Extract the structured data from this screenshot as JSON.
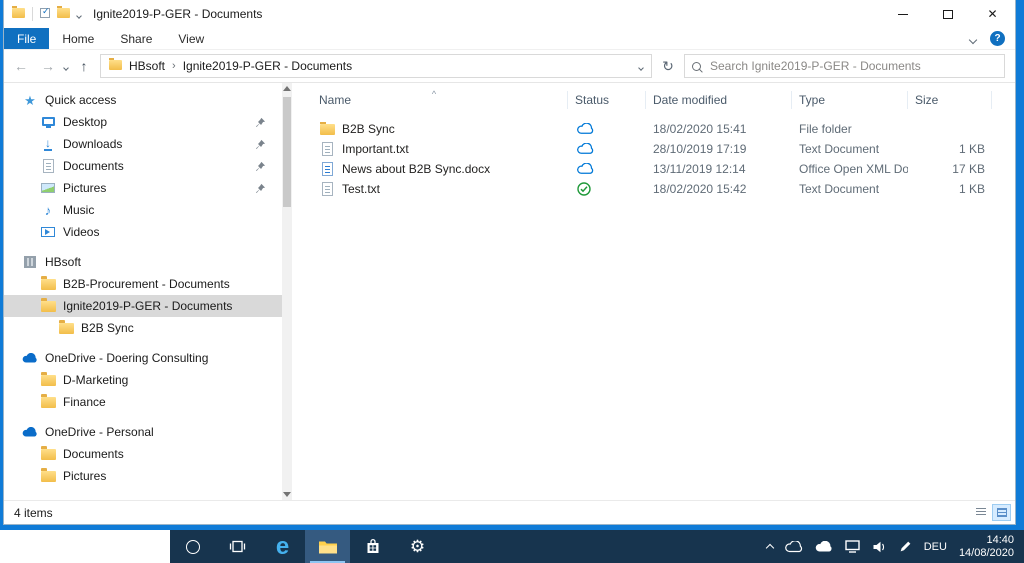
{
  "window": {
    "title": "Ignite2019-P-GER - Documents"
  },
  "ribbon": {
    "tabs": [
      {
        "label": "File",
        "active": true
      },
      {
        "label": "Home",
        "active": false
      },
      {
        "label": "Share",
        "active": false
      },
      {
        "label": "View",
        "active": false
      }
    ]
  },
  "addressbar": {
    "crumbs": [
      "HBsoft",
      "Ignite2019-P-GER - Documents"
    ],
    "search_placeholder": "Search Ignite2019-P-GER - Documents"
  },
  "sidebar": {
    "items": [
      {
        "label": "Quick access",
        "icon": "star",
        "level": 0,
        "pinned": false,
        "selected": false,
        "gap": false
      },
      {
        "label": "Desktop",
        "icon": "desktop",
        "level": 1,
        "pinned": true,
        "selected": false,
        "gap": false
      },
      {
        "label": "Downloads",
        "icon": "download",
        "level": 1,
        "pinned": true,
        "selected": false,
        "gap": false
      },
      {
        "label": "Documents",
        "icon": "document",
        "level": 1,
        "pinned": true,
        "selected": false,
        "gap": false
      },
      {
        "label": "Pictures",
        "icon": "pictures",
        "level": 1,
        "pinned": true,
        "selected": false,
        "gap": false
      },
      {
        "label": "Music",
        "icon": "music",
        "level": 1,
        "pinned": false,
        "selected": false,
        "gap": false
      },
      {
        "label": "Videos",
        "icon": "videos",
        "level": 1,
        "pinned": false,
        "selected": false,
        "gap": false
      },
      {
        "label": "HBsoft",
        "icon": "building",
        "level": 0,
        "pinned": false,
        "selected": false,
        "gap": true
      },
      {
        "label": "B2B-Procurement - Documents",
        "icon": "folder",
        "level": 1,
        "pinned": false,
        "selected": false,
        "gap": false
      },
      {
        "label": "Ignite2019-P-GER - Documents",
        "icon": "folder",
        "level": 1,
        "pinned": false,
        "selected": true,
        "gap": false
      },
      {
        "label": "B2B Sync",
        "icon": "folder",
        "level": 2,
        "pinned": false,
        "selected": false,
        "gap": false
      },
      {
        "label": "OneDrive - Doering Consulting",
        "icon": "cloud",
        "level": 0,
        "pinned": false,
        "selected": false,
        "gap": true
      },
      {
        "label": "D-Marketing",
        "icon": "folder",
        "level": 1,
        "pinned": false,
        "selected": false,
        "gap": false
      },
      {
        "label": "Finance",
        "icon": "folder",
        "level": 1,
        "pinned": false,
        "selected": false,
        "gap": false
      },
      {
        "label": "OneDrive - Personal",
        "icon": "cloud",
        "level": 0,
        "pinned": false,
        "selected": false,
        "gap": true
      },
      {
        "label": "Documents",
        "icon": "folder",
        "level": 1,
        "pinned": false,
        "selected": false,
        "gap": false
      },
      {
        "label": "Pictures",
        "icon": "folder",
        "level": 1,
        "pinned": false,
        "selected": false,
        "gap": false
      }
    ]
  },
  "file_list": {
    "columns": [
      "Name",
      "Status",
      "Date modified",
      "Type",
      "Size"
    ],
    "rows": [
      {
        "name": "B2B Sync",
        "icon": "folder",
        "status": "cloud",
        "modified": "18/02/2020 15:41",
        "type": "File folder",
        "size": ""
      },
      {
        "name": "Important.txt",
        "icon": "txt",
        "status": "cloud",
        "modified": "28/10/2019 17:19",
        "type": "Text Document",
        "size": "1 KB"
      },
      {
        "name": "News about B2B Sync.docx",
        "icon": "docx",
        "status": "cloud",
        "modified": "13/11/2019 12:14",
        "type": "Office Open XML Do...",
        "size": "17 KB"
      },
      {
        "name": "Test.txt",
        "icon": "txt",
        "status": "synced",
        "modified": "18/02/2020 15:42",
        "type": "Text Document",
        "size": "1 KB"
      }
    ]
  },
  "status_bar": {
    "items_count": "4 items"
  },
  "taskbar": {
    "tray": {
      "language": "DEU",
      "time": "14:40",
      "date": "14/08/2020"
    }
  },
  "glyphs": {
    "back": "←",
    "forward": "→",
    "up": "↑",
    "refresh": "↻",
    "crumb_sep": "›",
    "close": "✕",
    "sort": "^",
    "gear": "⚙",
    "help": "?",
    "edge": "e",
    "star": "★",
    "music": "♪",
    "download": "↓"
  },
  "colors": {
    "accent": "#1070c0",
    "taskbar": "#17344e",
    "desktop": "#0f7bd7",
    "status_cloud": "#0078d7",
    "status_synced": "#1f9939",
    "selection": "#d9d9d9"
  }
}
